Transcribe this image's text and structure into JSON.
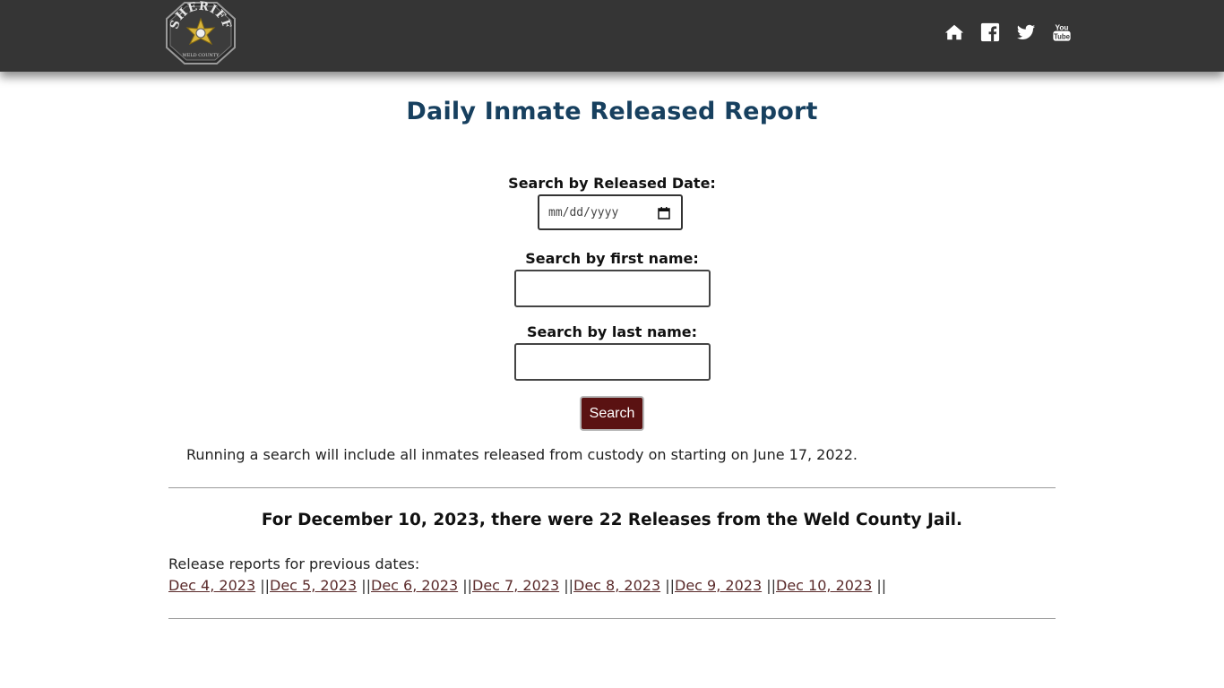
{
  "header": {
    "logo": {
      "text_top": "SHERIFF",
      "text_bottom": "WELD COUNTY"
    },
    "social_icons": [
      "home-icon",
      "facebook-icon",
      "twitter-icon",
      "youtube-icon"
    ]
  },
  "page": {
    "title": "Daily Inmate Released Report"
  },
  "search": {
    "date_label": "Search by Released Date:",
    "date_placeholder": "mm/dd/yyyy",
    "first_name_label": "Search by first name:",
    "last_name_label": "Search by last name:",
    "button_label": "Search",
    "note": "Running a search will include all inmates released from custody on starting on June 17, 2022."
  },
  "summary": {
    "text": "For December 10, 2023, there were 22 Releases from the Weld County Jail."
  },
  "previous": {
    "label": "Release reports for previous dates:",
    "dates": [
      "Dec 4, 2023",
      "Dec 5, 2023",
      "Dec 6, 2023",
      "Dec 7, 2023",
      "Dec 8, 2023",
      "Dec 9, 2023",
      "Dec 10, 2023"
    ],
    "separator": " ||"
  },
  "colors": {
    "header_bg": "#353535",
    "title": "#17405f",
    "button_bg": "#5a1212",
    "link": "#5a2a2a"
  }
}
